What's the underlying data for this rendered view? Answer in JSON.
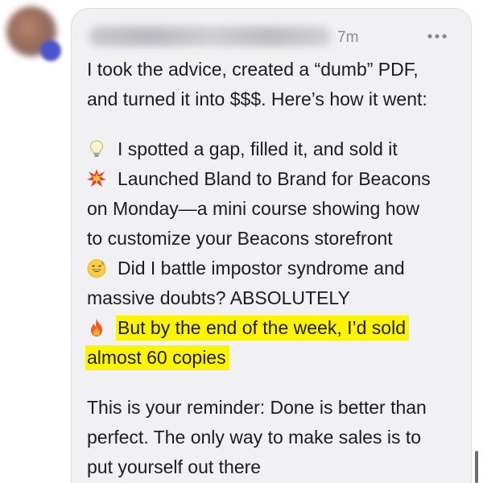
{
  "post": {
    "timestamp": "7m",
    "more_icon": "more-horizontal-icon",
    "intro": [
      "I took the advice, created a “dumb” PDF,",
      "and turned it into $$$. Here’s how it went:"
    ],
    "bullets": {
      "gap_line": {
        "emoji": "lightbulb-emoji",
        "text": "I spotted a gap, filled it, and sold it"
      },
      "launch": {
        "emoji": "collision-emoji",
        "lines": [
          "Launched Bland to Brand for Beacons",
          "on Monday—a mini course showing how",
          "to customize your Beacons storefront"
        ]
      },
      "doubt": {
        "emoji": "sweat-smile-emoji",
        "lines": [
          "Did I battle impostor syndrome and",
          "massive doubts? ABSOLUTELY"
        ]
      },
      "result": {
        "emoji": "fire-emoji",
        "lines": [
          "But by the end of the week, I’d sold",
          "almost 60 copies"
        ]
      }
    },
    "closing": [
      "This is your reminder: Done is better than",
      "perfect. The only way to make sales is to",
      "put yourself out there"
    ]
  },
  "colors": {
    "card_background": "#f1f1f3",
    "highlight": "#fdf500",
    "text": "#1c1c1e",
    "timestamp": "#8a8a8f"
  }
}
